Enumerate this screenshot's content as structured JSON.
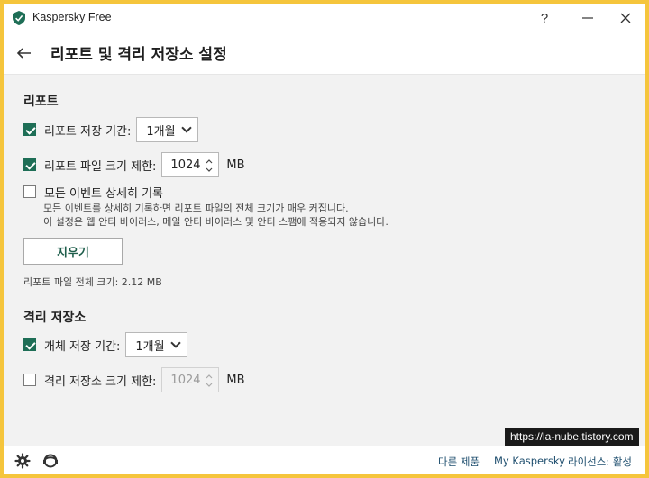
{
  "app": {
    "title": "Kaspersky Free",
    "help_symbol": "?",
    "minimize_symbol": "—",
    "close_symbol": "✕",
    "accent_color": "#1e6e56"
  },
  "header": {
    "back_icon": "arrow-left-icon",
    "title": "리포트 및 격리 저장소 설정"
  },
  "reports": {
    "section_title": "리포트",
    "store_period": {
      "label": "리포트 저장 기간:",
      "checked": true,
      "value": "1개월"
    },
    "size_limit": {
      "label": "리포트 파일 크기 제한:",
      "checked": true,
      "value": "1024",
      "unit": "MB"
    },
    "detailed": {
      "label": "모든 이벤트 상세히 기록",
      "checked": false,
      "desc_line1": "모든 이벤트를 상세히 기록하면 리포트 파일의 전체 크기가 매우 커집니다.",
      "desc_line2": "이 설정은 웹 안티 바이러스, 메일 안티 바이러스 및 안티 스팸에 적용되지 않습니다."
    },
    "clear_button": "지우기",
    "total_size": "리포트 파일 전체 크기: 2.12 MB"
  },
  "quarantine": {
    "section_title": "격리 저장소",
    "store_period": {
      "label": "개체 저장 기간:",
      "checked": true,
      "value": "1개월"
    },
    "size_limit": {
      "label": "격리 저장소 크기 제한:",
      "checked": false,
      "value": "1024",
      "unit": "MB"
    }
  },
  "footer": {
    "settings_icon": "gear-icon",
    "support_icon": "support-icon",
    "other_products": "다른 제품",
    "my_kaspersky": "My Kaspersky",
    "license": "라이선스: 활성"
  },
  "watermark": "https://la-nube.tistory.com"
}
